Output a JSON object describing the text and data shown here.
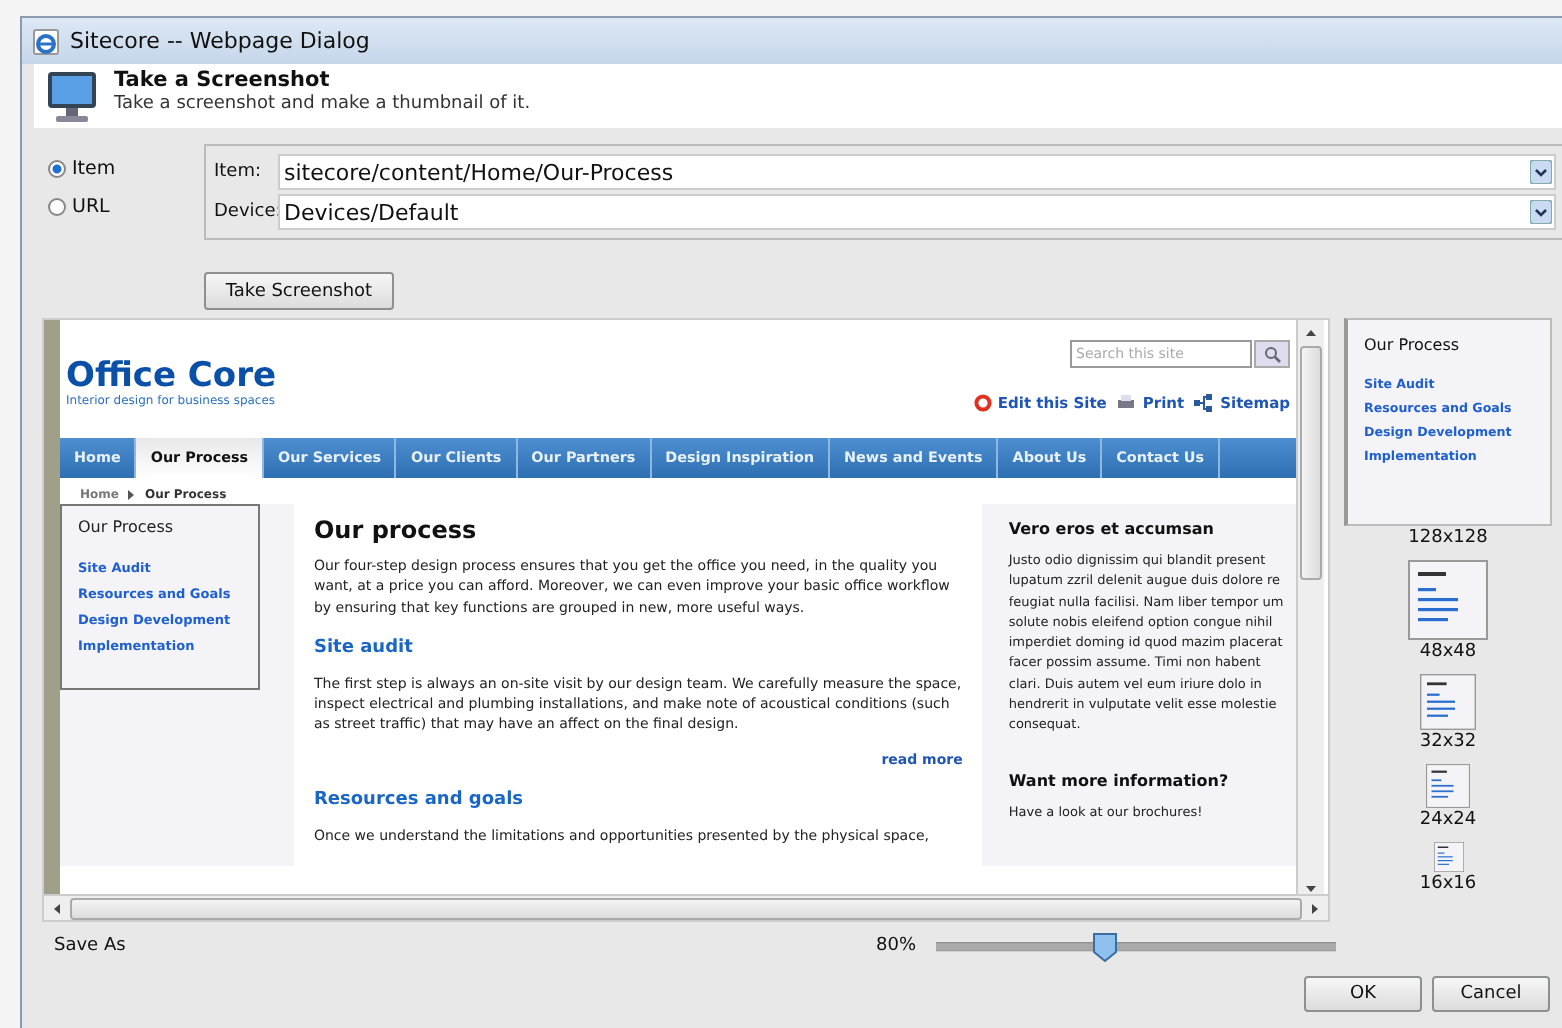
{
  "window": {
    "title": "Sitecore -- Webpage Dialog"
  },
  "header": {
    "title": "Take a Screenshot",
    "subtitle": "Take a screenshot and make a thumbnail of it."
  },
  "source": [
    {
      "label": "Item",
      "selected": true
    },
    {
      "label": "URL",
      "selected": false
    }
  ],
  "fields": [
    {
      "label": "Item:",
      "value": "sitecore/content/Home/Our-Process"
    },
    {
      "label": "Device:",
      "value": "Devices/Default"
    }
  ],
  "take_button": "Take Screenshot",
  "preview": {
    "logo": "Office Core",
    "tagline": "Interior design for business spaces",
    "search": {
      "placeholder": "Search this site"
    },
    "links": [
      "Edit this Site",
      "Print",
      "Sitemap"
    ],
    "nav": [
      {
        "label": "Home",
        "selected": false
      },
      {
        "label": "Our Process",
        "selected": true
      },
      {
        "label": "Our Services",
        "selected": false
      },
      {
        "label": "Our Clients",
        "selected": false
      },
      {
        "label": "Our Partners",
        "selected": false
      },
      {
        "label": "Design Inspiration",
        "selected": false
      },
      {
        "label": "News and Events",
        "selected": false
      },
      {
        "label": "About Us",
        "selected": false
      },
      {
        "label": "Contact Us",
        "selected": false
      }
    ],
    "breadcrumb": [
      "Home",
      "Our Process"
    ],
    "sidenav": {
      "title": "Our Process",
      "items": [
        "Site Audit",
        "Resources and Goals",
        "Design Development",
        "Implementation"
      ]
    },
    "main": {
      "title": "Our process",
      "intro": "Our four-step design process ensures that you get the office you need, in the quality you want, at a price you can afford. Moreover, we can even improve your basic office workflow by ensuring that key functions are grouped in new, more useful ways.",
      "sections": [
        {
          "heading": "Site audit",
          "text": "The first step is always an on-site visit by our design team. We carefully measure the space, inspect electrical and plumbing installations, and make note of acoustical conditions (such as street traffic) that may have an affect on the final design.",
          "more": "read more"
        },
        {
          "heading": "Resources and goals",
          "text": "Once we understand the limitations and opportunities presented by the physical space,"
        }
      ]
    },
    "aside": [
      {
        "title": "Vero eros et accumsan",
        "text": "Justo odio dignissim qui blandit present lupatum zzril delenit augue duis dolore re feugiat nulla facilisi. Nam liber tempor um solute nobis eleifend option congue nihil imperdiet doming id quod mazim placerat facer possim assume. Timi non habent clari. Duis autem vel eum iriure dolo in hendrerit in vulputate velit esse molestie consequat."
      },
      {
        "title": "Want more information?",
        "text": "Have a look at our brochures!"
      }
    ]
  },
  "thumbnails": {
    "large": {
      "title": "Our Process",
      "items": [
        "Site Audit",
        "Resources and Goals",
        "Design Development",
        "Implementation"
      ]
    },
    "sizes": [
      "128x128",
      "48x48",
      "32x32",
      "24x24",
      "16x16"
    ]
  },
  "save_as": "Save As",
  "zoom": {
    "reading": "80%",
    "level": 0.42
  },
  "buttons": [
    "OK",
    "Cancel"
  ]
}
